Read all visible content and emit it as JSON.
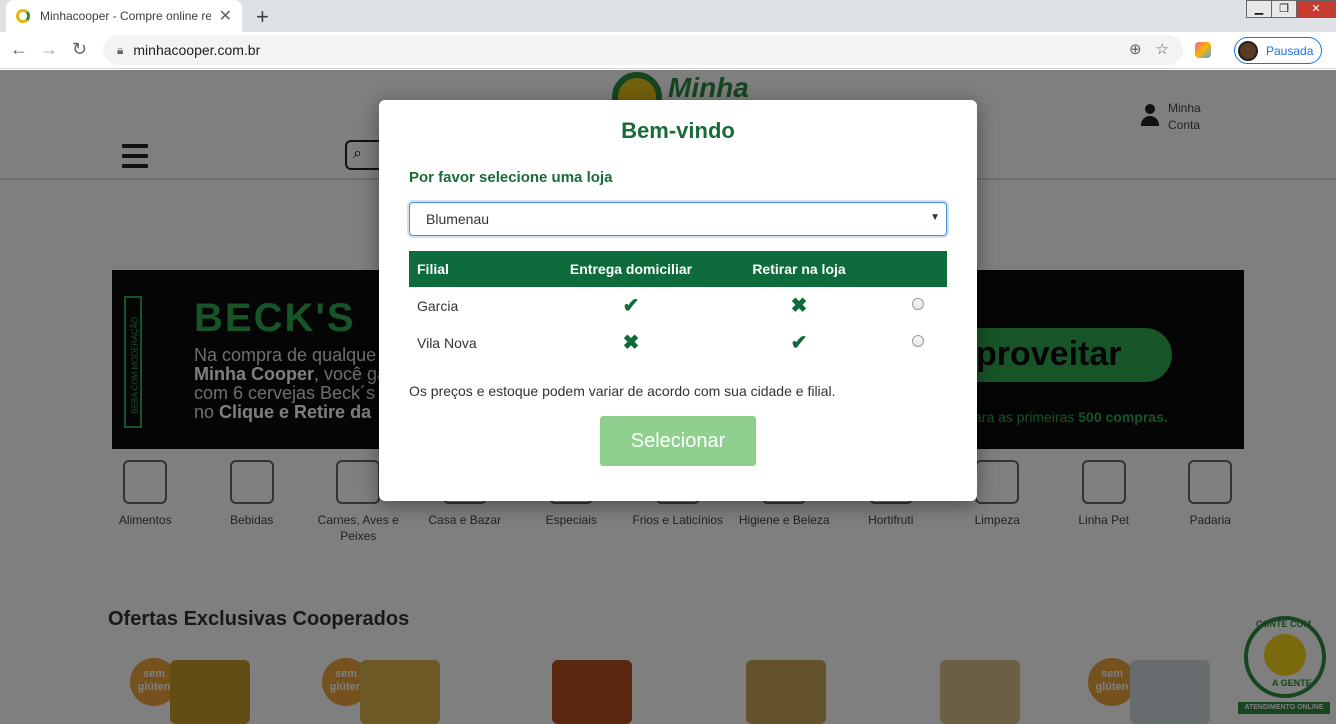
{
  "browser": {
    "tab_title": "Minhacooper - Compre online re",
    "new_tab": "+",
    "url": "minhacooper.com.br",
    "profile_label": "Pausada",
    "window_buttons": [
      "▁",
      "❐",
      "✕"
    ]
  },
  "header": {
    "logo_text": "Minha",
    "account_line1": "Minha",
    "account_line2": "Conta"
  },
  "banner": {
    "side_text": "BEBA COM MODERAÇÃO",
    "brand": "BECK'S",
    "line1": "Na compra de qualque",
    "line2_bold": "Minha Cooper",
    "line2_rest": ", você ga",
    "line3": "com 6 cervejas Beck´s",
    "line4_pre": "no ",
    "line4_bold": "Clique e Retire da",
    "cta": "proveitar",
    "fine_pre": "ara as primeiras ",
    "fine_bold": "500 compras."
  },
  "categories": [
    {
      "label": "Alimentos"
    },
    {
      "label": "Bebidas"
    },
    {
      "label": "Carnes, Aves e Peixes"
    },
    {
      "label": "Casa e Bazar"
    },
    {
      "label": "Especiais"
    },
    {
      "label": "Frios e Laticínios"
    },
    {
      "label": "Higiene e Beleza"
    },
    {
      "label": "Hortifruti"
    },
    {
      "label": "Limpeza"
    },
    {
      "label": "Linha Pet"
    },
    {
      "label": "Padaria"
    }
  ],
  "offers_title": "Ofertas Exclusivas Cooperados",
  "badge_text": "sem glúten",
  "chat": {
    "top": "CONTE COM",
    "bottom": "A GENTE",
    "bar": "ATENDIMENTO ONLINE"
  },
  "modal": {
    "title": "Bem-vindo",
    "prompt": "Por favor selecione uma loja",
    "selected_city": "Blumenau",
    "columns": [
      "Filial",
      "Entrega domiciliar",
      "Retirar na loja"
    ],
    "stores": [
      {
        "name": "Garcia",
        "delivery": true,
        "pickup": false
      },
      {
        "name": "Vila Nova",
        "delivery": false,
        "pickup": true
      }
    ],
    "note": "Os preços e estoque podem variar de acordo com sua cidade e filial.",
    "button": "Selecionar"
  },
  "colors": {
    "brand_green": "#0d6b3c",
    "button_disabled": "#8fd08f",
    "becks_green": "#2fa84f"
  }
}
